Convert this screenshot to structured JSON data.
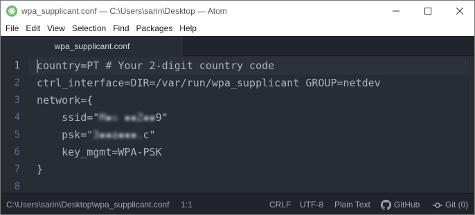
{
  "window": {
    "title": "wpa_supplicant.conf — C:\\Users\\sarin\\Desktop — Atom",
    "app_icon": "atom-icon",
    "controls": {
      "minimize": "minimize-icon",
      "maximize": "maximize-icon",
      "close": "close-icon"
    }
  },
  "menu": [
    "File",
    "Edit",
    "View",
    "Selection",
    "Find",
    "Packages",
    "Help"
  ],
  "tabs": [
    {
      "label": "wpa_supplicant.conf",
      "active": true
    }
  ],
  "editor": {
    "line_numbers": [
      "1",
      "2",
      "3",
      "4",
      "5",
      "6",
      "7",
      "8"
    ],
    "lines": [
      "country=PT # Your 2-digit country code",
      "ctrl_interface=DIR=/var/run/wpa_supplicant GROUP=netdev",
      "network={",
      "    ssid=\"",
      "    psk=\"",
      "    key_mgmt=WPA-PSK",
      "}",
      ""
    ],
    "ssid_suffix": "9\"",
    "psk_suffix": "c\"",
    "active_line": 1
  },
  "status": {
    "path": "C:\\Users\\sarin\\Desktop\\wpa_supplicant.conf",
    "cursor_position": "1:1",
    "line_ending": "CRLF",
    "encoding": "UTF-8",
    "grammar": "Plain Text",
    "github": "GitHub",
    "git": "Git (0)"
  },
  "colors": {
    "editor_bg": "#282c34",
    "panel_bg": "#21252b",
    "text": "#abb2bf",
    "gutter_text": "#636d83",
    "cursor": "#528bff"
  }
}
